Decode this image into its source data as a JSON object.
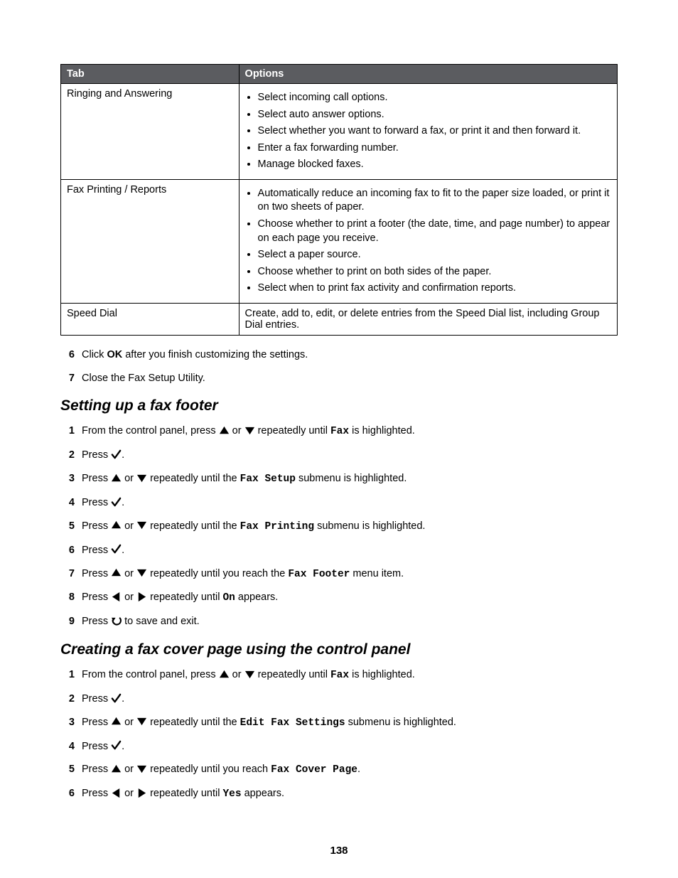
{
  "table": {
    "header_tab": "Tab",
    "header_options": "Options",
    "rows": [
      {
        "tab": "Ringing and Answering",
        "options": [
          "Select incoming call options.",
          "Select auto answer options.",
          "Select whether you want to forward a fax, or print it and then forward it.",
          "Enter a fax forwarding number.",
          "Manage blocked faxes."
        ]
      },
      {
        "tab": "Fax Printing / Reports",
        "options": [
          "Automatically reduce an incoming fax to fit to the paper size loaded, or print it on two sheets of paper.",
          "Choose whether to print a footer (the date, time, and page number) to appear on each page you receive.",
          "Select a paper source.",
          "Choose whether to print on both sides of the paper.",
          "Select when to print fax activity and confirmation reports."
        ]
      },
      {
        "tab": "Speed Dial",
        "plain": "Create, add to, edit, or delete entries from the Speed Dial list, including Group Dial entries."
      }
    ]
  },
  "pre_steps": {
    "s6_a": "Click ",
    "s6_ok": "OK",
    "s6_b": " after you finish customizing the settings.",
    "s7": "Close the Fax Setup Utility."
  },
  "section1": {
    "title": "Setting up a fax footer",
    "s1_a": "From the control panel, press ",
    "s1_b": " or ",
    "s1_c": " repeatedly until ",
    "s1_fax": "Fax",
    "s1_d": " is highlighted.",
    "s2_a": "Press ",
    "s2_b": ".",
    "s3_a": "Press ",
    "s3_b": " or ",
    "s3_c": " repeatedly until the ",
    "s3_faxsetup": "Fax Setup",
    "s3_d": " submenu is highlighted.",
    "s4_a": "Press ",
    "s4_b": ".",
    "s5_a": "Press ",
    "s5_b": " or ",
    "s5_c": " repeatedly until the ",
    "s5_faxprinting": "Fax Printing",
    "s5_d": " submenu is highlighted.",
    "s6_a": "Press ",
    "s6_b": ".",
    "s7_a": "Press ",
    "s7_b": " or ",
    "s7_c": " repeatedly until you reach the ",
    "s7_faxfooter": "Fax Footer",
    "s7_d": " menu item.",
    "s8_a": "Press ",
    "s8_b": " or ",
    "s8_c": " repeatedly until ",
    "s8_on": "On",
    "s8_d": " appears.",
    "s9_a": "Press ",
    "s9_b": " to save and exit."
  },
  "section2": {
    "title": "Creating a fax cover page using the control panel",
    "s1_a": "From the control panel, press ",
    "s1_b": " or ",
    "s1_c": " repeatedly until ",
    "s1_fax": "Fax",
    "s1_d": " is highlighted.",
    "s2_a": "Press ",
    "s2_b": ".",
    "s3_a": "Press ",
    "s3_b": " or ",
    "s3_c": " repeatedly until the ",
    "s3_editfax": "Edit Fax Settings",
    "s3_d": " submenu is highlighted.",
    "s4_a": "Press ",
    "s4_b": ".",
    "s5_a": "Press ",
    "s5_b": " or ",
    "s5_c": " repeatedly until you reach ",
    "s5_faxcover": "Fax Cover Page",
    "s5_d": ".",
    "s6_a": "Press ",
    "s6_b": " or ",
    "s6_c": " repeatedly until ",
    "s6_yes": "Yes",
    "s6_d": " appears."
  },
  "page_number": "138",
  "nums": {
    "n1": "1",
    "n2": "2",
    "n3": "3",
    "n4": "4",
    "n5": "5",
    "n6": "6",
    "n7": "7",
    "n8": "8",
    "n9": "9"
  }
}
